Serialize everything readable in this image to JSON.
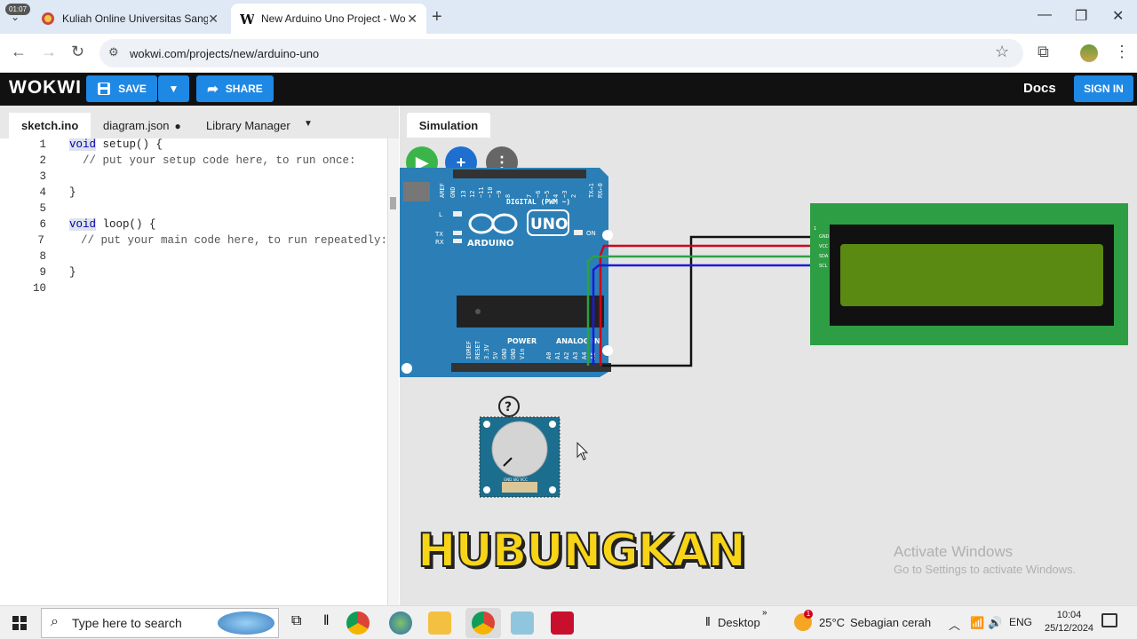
{
  "browser": {
    "tabs": [
      {
        "title": "Kuliah Online Universitas Sangg",
        "active": false
      },
      {
        "title": "New Arduino Uno Project - Wo",
        "active": true
      }
    ],
    "url": "wokwi.com/projects/new/arduino-uno",
    "corner_time": "01:07"
  },
  "wokwi": {
    "logo": "WOKWI",
    "save_label": "SAVE",
    "share_label": "SHARE",
    "docs_label": "Docs",
    "signin_label": "SIGN IN"
  },
  "editor": {
    "tabs": [
      "sketch.ino",
      "diagram.json",
      "Library Manager"
    ],
    "active_tab": "sketch.ino",
    "line_numbers": [
      "1",
      "2",
      "3",
      "4",
      "5",
      "6",
      "7",
      "8",
      "9",
      "10"
    ],
    "lines": {
      "l1_kw": "void",
      "l1_rest": " setup() {",
      "l2": "  // put your setup code here, to run once:",
      "l4": "}",
      "l6_kw": "void",
      "l6_rest": " loop() {",
      "l7": "  // put your main code here, to run repeatedly:",
      "l9": "}"
    }
  },
  "simulation": {
    "tab_label": "Simulation",
    "board": {
      "brand": "ARDUINO",
      "model": "UNO",
      "digital_label": "DIGITAL (PWM ~)",
      "power_label": "POWER",
      "analog_label": "ANALOG IN",
      "on_label": "ON",
      "l_label": "L",
      "tx_label": "TX",
      "rx_label": "RX",
      "digital_pins": [
        "AREF",
        "GND",
        "13",
        "12",
        "~11",
        "~10",
        "~9",
        "8",
        "7",
        "~6",
        "~5",
        "4",
        "~3",
        "2",
        "TX→1",
        "RX←0"
      ],
      "power_pins": [
        "IOREF",
        "RESET",
        "3.3V",
        "5V",
        "GND",
        "GND",
        "Vin"
      ],
      "analog_pins": [
        "A0",
        "A1",
        "A2",
        "A3",
        "A4",
        "A5"
      ]
    },
    "lcd_pins": [
      "GND",
      "VCC",
      "SDA",
      "SCL"
    ],
    "lcd_pin1": "1",
    "pot_pins": "GND SIG VCC",
    "help_glyph": "?",
    "wire_colors": {
      "black": "#111111",
      "red": "#d0021b",
      "green": "#2ea043",
      "blue": "#1a1adb"
    }
  },
  "overlay": {
    "caption": "HUBUNGKAN",
    "activate_title": "Activate Windows",
    "activate_sub": "Go to Settings to activate Windows."
  },
  "taskbar": {
    "search_placeholder": "Type here to search",
    "desktop_label": "Desktop",
    "weather": "25°C",
    "weather_desc": "Sebagian cerah",
    "lang": "ENG",
    "time": "10:04",
    "date": "25/12/2024",
    "notif_count": "1"
  }
}
